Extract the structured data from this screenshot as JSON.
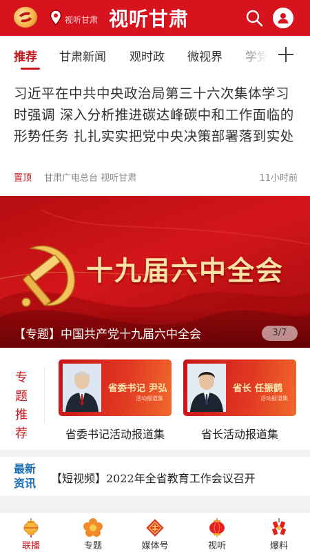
{
  "header": {
    "app_subtitle": "视听甘肃",
    "app_title": "视听甘肃",
    "icons": [
      "app-logo",
      "location-pin-icon",
      "search-icon",
      "user-icon"
    ],
    "brand_color": "#d7131e"
  },
  "tabs": [
    {
      "label": "推荐",
      "active": true
    },
    {
      "label": "甘肃新闻",
      "active": false
    },
    {
      "label": "观时政",
      "active": false
    },
    {
      "label": "微视界",
      "active": false
    },
    {
      "label": "学党",
      "active": false
    }
  ],
  "headline": {
    "title": "习近平在中共中央政治局第三十六次集体学习时强调 深入分析推进碳达峰碳中和工作面临的形势任务 扎扎实实把党中央决策部署落到实处",
    "pin_label": "置顶",
    "source": "甘肃广电总台 视听甘肃",
    "time": "11小时前"
  },
  "banner": {
    "title": "十九届六中全会",
    "caption": "【专题】中国共产党十九届六中全会",
    "pager": "3/7"
  },
  "special_topics": {
    "label": "专题推荐",
    "cards": [
      {
        "card_title": "省委书记 尹弘",
        "card_subtitle": "活动报道集",
        "caption": "省委书记活动报道集"
      },
      {
        "card_title": "省长 任振鹤",
        "card_subtitle": "活动报道集",
        "caption": "省长活动报道集"
      }
    ]
  },
  "news_ticker": {
    "label": "最新资讯",
    "text": "【短视频】2022年全省教育工作会议召开"
  },
  "bottom_nav": [
    {
      "label": "联播",
      "icon": "lantern-icon",
      "active": true
    },
    {
      "label": "专题",
      "icon": "flower-icon",
      "active": false
    },
    {
      "label": "媒体号",
      "icon": "seal-icon",
      "active": false
    },
    {
      "label": "视听",
      "icon": "red-lantern-icon",
      "active": false
    },
    {
      "label": "爆料",
      "icon": "firecracker-icon",
      "active": false
    }
  ]
}
